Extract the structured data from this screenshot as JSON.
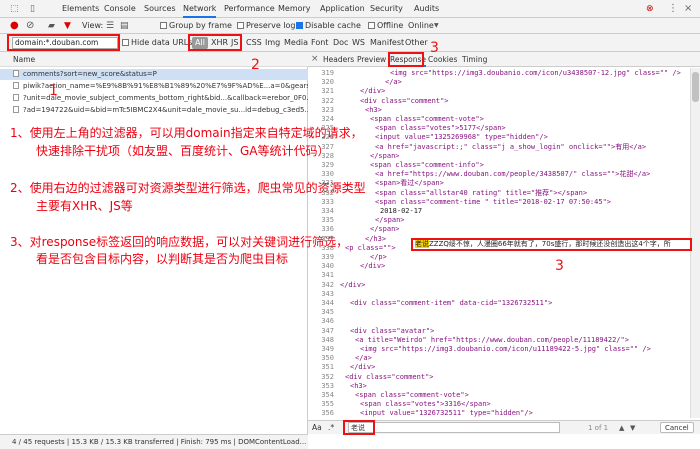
{
  "devtools": {
    "tabs": [
      "Elements",
      "Console",
      "Sources",
      "Network",
      "Performance",
      "Memory",
      "Application",
      "Security",
      "Audits"
    ],
    "active_tab": "Network"
  },
  "toolbar": {
    "view_label": "View:",
    "group_by_frame": "Group by frame",
    "preserve_log": "Preserve log",
    "disable_cache": "Disable cache",
    "offline": "Offline",
    "online": "Online"
  },
  "filter": {
    "input_value": "domain:*.douban.com",
    "hide_data_urls": "Hide data URLs",
    "types": [
      "All",
      "XHR",
      "JS",
      "CSS",
      "Img",
      "Media",
      "Font",
      "Doc",
      "WS",
      "Manifest",
      "Other"
    ]
  },
  "requests": {
    "name_header": "Name",
    "rows": [
      "comments?sort=new_score&status=P",
      "piwik?action_name=%E9%8B%91%E8%B1%89%20%E7%9F%AD%E...a=0&gears...",
      "?unit=dale_movie_subject_comments_bottom_right&bid...&callback=erebor_0F0...",
      "?ad=194722&uid=&bid=mTc5IBMC2X4&unit=dale_movie_su...id=debug_c3ed5..."
    ]
  },
  "status": "4 / 45 requests | 15.3 KB / 15.3 KB transferred | Finish: 795 ms | DOMContentLoad...",
  "annotations": {
    "num1": "1",
    "num2": "2",
    "num3a": "3",
    "num3b": "3",
    "num3c": "3",
    "a1_line1": "1、使用左上角的过滤器，可以用domain指定来自特定域的请求，",
    "a1_line2": "快速排除干扰项（如友盟、百度统计、GA等统计代码）",
    "a2_line1": "2、使用右边的过滤器可对资源类型进行筛选，爬虫常见的资源类型",
    "a2_line2": "主要有XHR、JS等",
    "a3_line1": "3、对response标签返回的响应数据，可以对关键词进行筛选，",
    "a3_line2": "看是否包含目标内容，以判断其是否为爬虫目标"
  },
  "detail": {
    "tabs": [
      "Headers",
      "Preview",
      "Response",
      "Cookies",
      "Timing"
    ],
    "active_tab": "Response",
    "close_glyph": "×",
    "lines": [
      {
        "n": "319",
        "code": "<img src=\"https://img3.doubanio.com/icon/u3438507-12.jpg\" class=\"\" />"
      },
      {
        "n": "320",
        "code": "</a>"
      },
      {
        "n": "321",
        "code": "</div>"
      },
      {
        "n": "322",
        "code": "<div class=\"comment\">"
      },
      {
        "n": "323",
        "code": "<h3>"
      },
      {
        "n": "324",
        "code": "<span class=\"comment-vote\">"
      },
      {
        "n": "325",
        "code": "<span class=\"votes\">5177</span>"
      },
      {
        "n": "326",
        "code": "<input value=\"1325269968\" type=\"hidden\"/>"
      },
      {
        "n": "327",
        "code": "<a href=\"javascript:;\" class=\"j a_show_login\" onclick=\"\">有用</a>"
      },
      {
        "n": "328",
        "code": "</span>"
      },
      {
        "n": "329",
        "code": "<span class=\"comment-info\">"
      },
      {
        "n": "330",
        "code": "<a href=\"https://www.douban.com/people/3438507/\" class=\"\">花甜</a>"
      },
      {
        "n": "331",
        "code": "<span>看过</span>"
      },
      {
        "n": "332",
        "code": "<span class=\"allstar40 rating\" title=\"推荐\"></span>"
      },
      {
        "n": "333",
        "code": "<span class=\"comment-time \" title=\"2018-02-17 07:50:45\">"
      },
      {
        "n": "334",
        "code": "2018-02-17"
      },
      {
        "n": "335",
        "code": "</span>"
      },
      {
        "n": "336",
        "code": "</span>"
      },
      {
        "n": "337",
        "code": "</h3>"
      },
      {
        "n": "338",
        "code": "<p class=\"\">"
      },
      {
        "n": "339",
        "code": "</p>"
      },
      {
        "n": "340",
        "code": "</div>"
      },
      {
        "n": "341",
        "code": ""
      },
      {
        "n": "342",
        "code": "</div>"
      },
      {
        "n": "343",
        "code": ""
      },
      {
        "n": "344",
        "code": "<div class=\"comment-item\" data-cid=\"1326732511\">"
      },
      {
        "n": "345",
        "code": ""
      },
      {
        "n": "346",
        "code": ""
      },
      {
        "n": "347",
        "code": "<div class=\"avatar\">"
      },
      {
        "n": "348",
        "code": "<a title=\"Weirdo\" href=\"https://www.douban.com/people/11189422/\">"
      },
      {
        "n": "349",
        "code": "<img src=\"https://img3.doubanio.com/icon/u11189422-5.jpg\" class=\"\" />"
      },
      {
        "n": "350",
        "code": "</a>"
      },
      {
        "n": "351",
        "code": "</div>"
      },
      {
        "n": "352",
        "code": "<div class=\"comment\">"
      },
      {
        "n": "353",
        "code": "<h3>"
      },
      {
        "n": "354",
        "code": "<span class=\"comment-vote\">"
      },
      {
        "n": "355",
        "code": "<span class=\"votes\">3316</span>"
      },
      {
        "n": "356",
        "code": "<input value=\"1326732511\" type=\"hidden\"/>"
      },
      {
        "n": "357",
        "code": "<a href=\"javascript:;\" class=\"j a_show_login\" onclick=\"\">有用</a>"
      }
    ],
    "highlight_keyword": "老说",
    "highlight_rest": "ZZZQ绥不惊，人漫圈66年就有了，70s盛行，那时候还没创造出这4个字，所"
  },
  "search": {
    "aa_label": "Aa",
    "regex_label": ".*",
    "value": "老说",
    "match_count": "1 of 1",
    "cancel_label": "Cancel"
  }
}
